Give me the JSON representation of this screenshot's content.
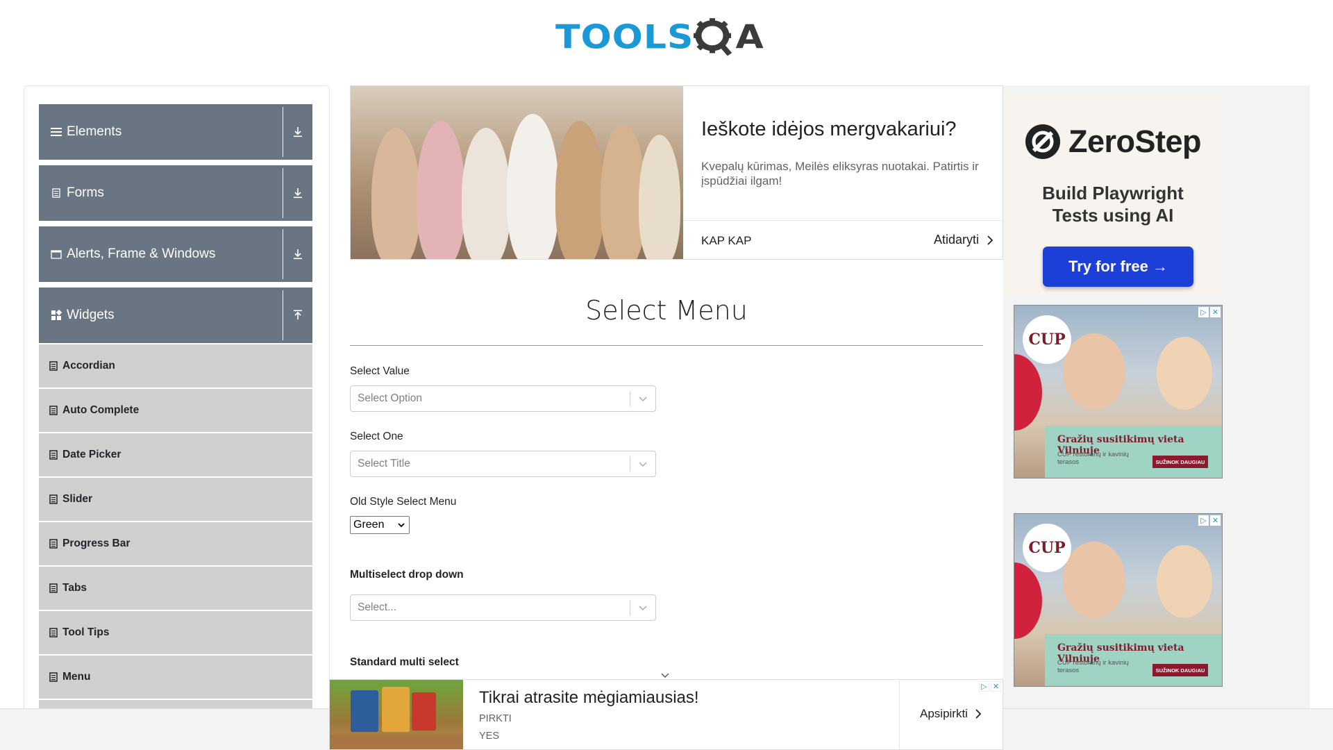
{
  "header": {
    "logo_tools": "TOOLS",
    "logo_qa": "QA"
  },
  "sidebar": {
    "groups": [
      {
        "label": "Elements",
        "icon": "hamburger-icon",
        "arrow": "download-icon"
      },
      {
        "label": "Forms",
        "icon": "form-icon",
        "arrow": "download-icon"
      },
      {
        "label": "Alerts, Frame & Windows",
        "icon": "window-icon",
        "arrow": "download-icon"
      },
      {
        "label": "Widgets",
        "icon": "widgets-icon",
        "arrow": "upload-icon"
      }
    ],
    "items": [
      {
        "label": "Accordian"
      },
      {
        "label": "Auto Complete"
      },
      {
        "label": "Date Picker"
      },
      {
        "label": "Slider"
      },
      {
        "label": "Progress Bar"
      },
      {
        "label": "Tabs"
      },
      {
        "label": "Tool Tips"
      },
      {
        "label": "Menu"
      }
    ]
  },
  "top_ad": {
    "title": "Ieškote idėjos mergvakariui?",
    "text": "Kvepalų kūrimas, Meilės eliksyras nuotakai. Patirtis ir įspūdžiai ilgam!",
    "advertiser": "KAP KAP",
    "cta": "Atidaryti"
  },
  "main": {
    "title": "Select Menu",
    "select_value": {
      "label": "Select Value",
      "placeholder": "Select Option"
    },
    "select_one": {
      "label": "Select One",
      "placeholder": "Select Title"
    },
    "old_style": {
      "label": "Old Style Select Menu",
      "value": "Green"
    },
    "multiselect": {
      "label": "Multiselect drop down",
      "placeholder": "Select..."
    },
    "standard_multi": {
      "label": "Standard multi select"
    }
  },
  "right_ads": {
    "zerostep": {
      "brand": "ZeroStep",
      "tagline_1": "Build Playwright",
      "tagline_2": "Tests using AI",
      "button": "Try for free →"
    },
    "cup": {
      "logo": "CUP",
      "title": "Gražių susitikimų vieta Vilniuje",
      "subtitle": "CUP restoranų ir kavinių terasos",
      "button": "SUŽINOK DAUGIAU"
    }
  },
  "bottom_ad": {
    "title": "Tikrai atrasite mėgiamiausias!",
    "line1": "PIRKTI",
    "line2": "YES",
    "cta": "Apsipirkti"
  },
  "colors": {
    "sidebar_group_bg": "#697582",
    "sidebar_item_bg": "#d0d0d0",
    "logo_blue": "#1b98d6",
    "zerostep_button": "#1c3fd8"
  }
}
